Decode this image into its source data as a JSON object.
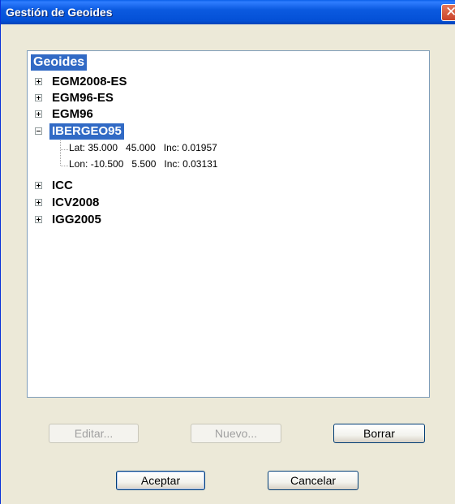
{
  "window": {
    "title": "Gestión de Geoides"
  },
  "tree": {
    "root_label": "Geoides",
    "nodes": [
      {
        "label": "EGM2008-ES",
        "expanded": false
      },
      {
        "label": "EGM96-ES",
        "expanded": false
      },
      {
        "label": "EGM96",
        "expanded": false
      },
      {
        "label": "IBERGEO95",
        "expanded": true,
        "selected": true,
        "children": [
          "Lat: 35.000   45.000   Inc: 0.01957",
          "Lon: -10.500   5.500   Inc: 0.03131"
        ]
      },
      {
        "label": "ICC",
        "expanded": false
      },
      {
        "label": "ICV2008",
        "expanded": false
      },
      {
        "label": "IGG2005",
        "expanded": false
      }
    ]
  },
  "buttons": {
    "edit": "Editar...",
    "new": "Nuevo...",
    "delete": "Borrar",
    "accept": "Aceptar",
    "cancel": "Cancelar"
  }
}
